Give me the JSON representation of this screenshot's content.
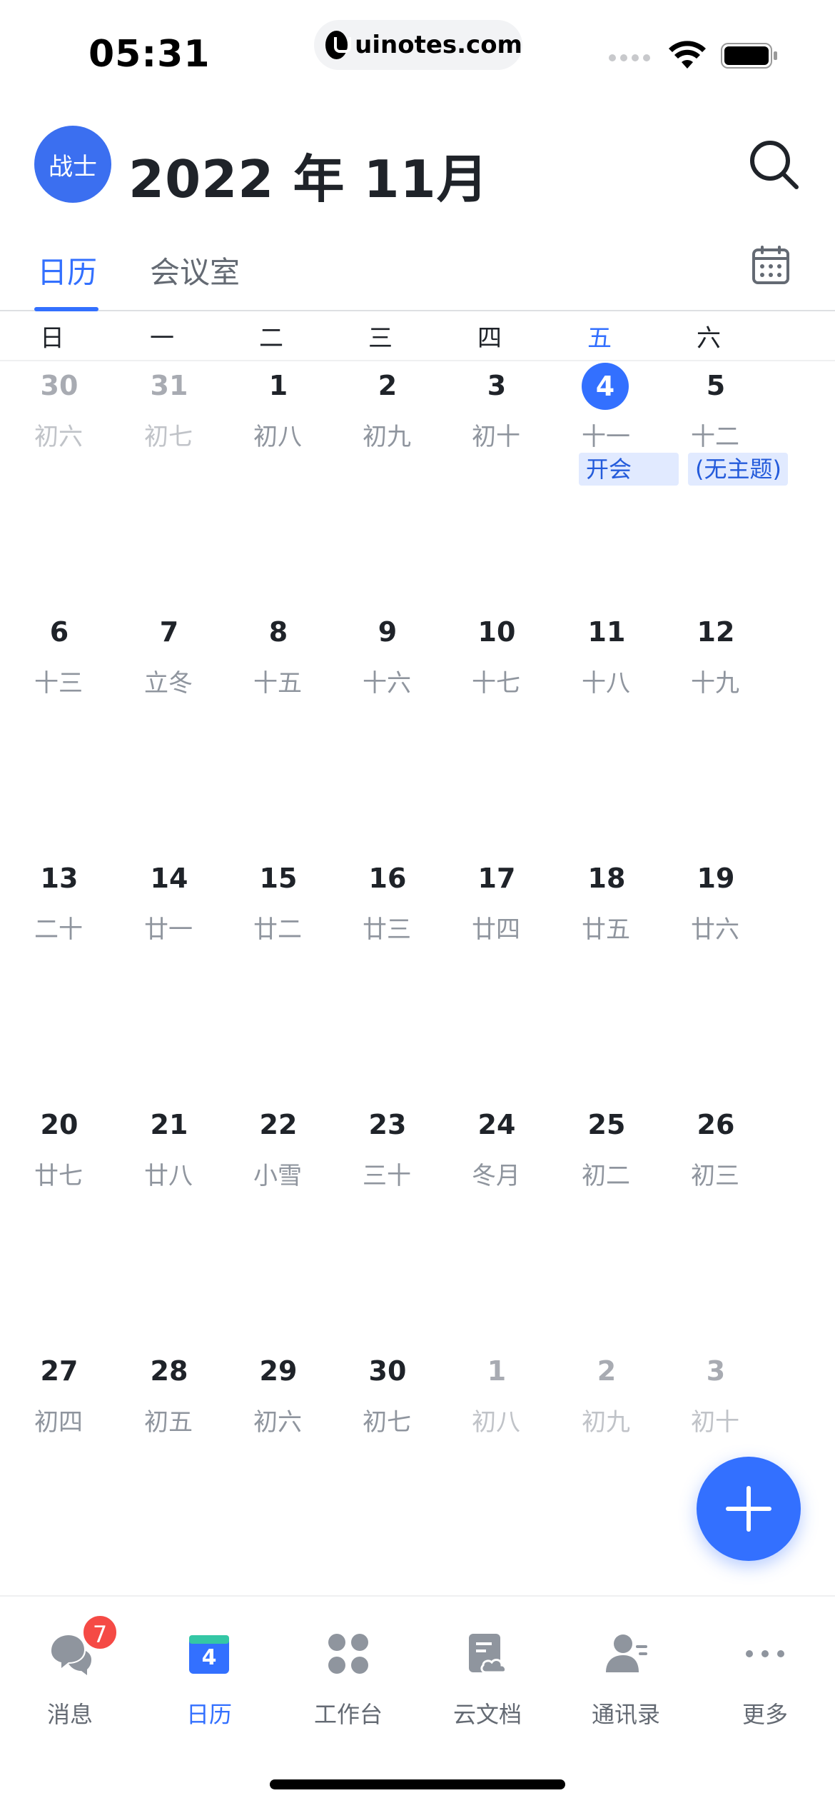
{
  "status_bar": {
    "time": "05:31",
    "url": "uinotes.com"
  },
  "header": {
    "avatar_text": "战士",
    "title": "2022 年 11月"
  },
  "tabs": [
    {
      "label": "日历",
      "active": true
    },
    {
      "label": "会议室",
      "active": false
    }
  ],
  "weekdays": [
    "日",
    "一",
    "二",
    "三",
    "四",
    "五",
    "六"
  ],
  "today_column": 5,
  "weeks": [
    [
      {
        "num": "30",
        "lunar": "初六",
        "other": true
      },
      {
        "num": "31",
        "lunar": "初七",
        "other": true
      },
      {
        "num": "1",
        "lunar": "初八"
      },
      {
        "num": "2",
        "lunar": "初九"
      },
      {
        "num": "3",
        "lunar": "初十"
      },
      {
        "num": "4",
        "lunar": "十一",
        "today": true,
        "event": "开会"
      },
      {
        "num": "5",
        "lunar": "十二",
        "event": "(无主题)"
      }
    ],
    [
      {
        "num": "6",
        "lunar": "十三"
      },
      {
        "num": "7",
        "lunar": "立冬"
      },
      {
        "num": "8",
        "lunar": "十五"
      },
      {
        "num": "9",
        "lunar": "十六"
      },
      {
        "num": "10",
        "lunar": "十七"
      },
      {
        "num": "11",
        "lunar": "十八"
      },
      {
        "num": "12",
        "lunar": "十九"
      }
    ],
    [
      {
        "num": "13",
        "lunar": "二十"
      },
      {
        "num": "14",
        "lunar": "廿一"
      },
      {
        "num": "15",
        "lunar": "廿二"
      },
      {
        "num": "16",
        "lunar": "廿三"
      },
      {
        "num": "17",
        "lunar": "廿四"
      },
      {
        "num": "18",
        "lunar": "廿五"
      },
      {
        "num": "19",
        "lunar": "廿六"
      }
    ],
    [
      {
        "num": "20",
        "lunar": "廿七"
      },
      {
        "num": "21",
        "lunar": "廿八"
      },
      {
        "num": "22",
        "lunar": "小雪"
      },
      {
        "num": "23",
        "lunar": "三十"
      },
      {
        "num": "24",
        "lunar": "冬月"
      },
      {
        "num": "25",
        "lunar": "初二"
      },
      {
        "num": "26",
        "lunar": "初三"
      }
    ],
    [
      {
        "num": "27",
        "lunar": "初四"
      },
      {
        "num": "28",
        "lunar": "初五"
      },
      {
        "num": "29",
        "lunar": "初六"
      },
      {
        "num": "30",
        "lunar": "初七"
      },
      {
        "num": "1",
        "lunar": "初八",
        "other": true
      },
      {
        "num": "2",
        "lunar": "初九",
        "other": true
      },
      {
        "num": "3",
        "lunar": "初十",
        "other": true
      }
    ]
  ],
  "bottom_nav": [
    {
      "label": "消息",
      "icon": "chat-bubbles-icon",
      "badge": "7"
    },
    {
      "label": "日历",
      "icon": "calendar-icon",
      "active": true,
      "icon_text": "4"
    },
    {
      "label": "工作台",
      "icon": "apps-grid-icon"
    },
    {
      "label": "云文档",
      "icon": "cloud-doc-icon"
    },
    {
      "label": "通讯录",
      "icon": "contacts-icon"
    },
    {
      "label": "更多",
      "icon": "more-dots-icon"
    }
  ],
  "colors": {
    "accent": "#3370ff",
    "event_bg": "#e1eaff",
    "badge": "#f54a45"
  }
}
